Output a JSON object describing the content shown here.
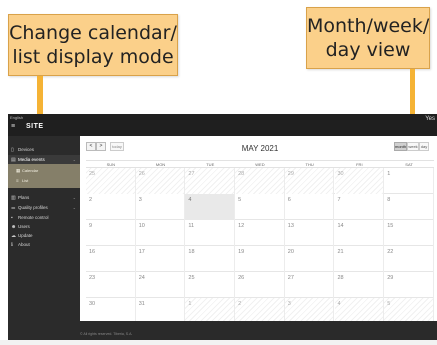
{
  "annotations": {
    "left_callout": [
      "Change calendar/",
      "list display mode"
    ],
    "right_callout": [
      "Month/week/",
      "day view"
    ]
  },
  "topbar": {
    "language": "English",
    "brand": "SITE",
    "user": "Yes"
  },
  "sidebar": {
    "items": [
      {
        "label": "Devices",
        "icon": "device-icon"
      },
      {
        "label": "Media events",
        "icon": "chart-icon"
      },
      {
        "label": "Plans",
        "icon": "grid-icon"
      },
      {
        "label": "Quality profiles",
        "icon": "sliders-icon"
      },
      {
        "label": "Remote control",
        "icon": "remote-icon"
      },
      {
        "label": "Users",
        "icon": "users-icon"
      },
      {
        "label": "Update",
        "icon": "cloud-icon"
      },
      {
        "label": "About",
        "icon": "info-icon"
      }
    ],
    "submenu": [
      {
        "label": "Calendar",
        "icon": "calendar-icon"
      },
      {
        "label": "List",
        "icon": "list-icon"
      }
    ]
  },
  "calendar": {
    "prev": "<",
    "next": ">",
    "today": "today",
    "title": "MAY 2021",
    "views": [
      "month",
      "week",
      "day"
    ],
    "active_view": "month",
    "weekdays": [
      "SUN",
      "MON",
      "TUE",
      "WED",
      "THU",
      "FRI",
      "SAT"
    ],
    "weeks": [
      [
        {
          "d": "25",
          "o": true
        },
        {
          "d": "26",
          "o": true
        },
        {
          "d": "27",
          "o": true
        },
        {
          "d": "28",
          "o": true
        },
        {
          "d": "29",
          "o": true
        },
        {
          "d": "30",
          "o": true
        },
        {
          "d": "1"
        }
      ],
      [
        {
          "d": "2"
        },
        {
          "d": "3"
        },
        {
          "d": "4",
          "t": true
        },
        {
          "d": "5"
        },
        {
          "d": "6"
        },
        {
          "d": "7"
        },
        {
          "d": "8"
        }
      ],
      [
        {
          "d": "9"
        },
        {
          "d": "10"
        },
        {
          "d": "11"
        },
        {
          "d": "12"
        },
        {
          "d": "13"
        },
        {
          "d": "14"
        },
        {
          "d": "15"
        }
      ],
      [
        {
          "d": "16"
        },
        {
          "d": "17"
        },
        {
          "d": "18"
        },
        {
          "d": "19"
        },
        {
          "d": "20"
        },
        {
          "d": "21"
        },
        {
          "d": "22"
        }
      ],
      [
        {
          "d": "23"
        },
        {
          "d": "24"
        },
        {
          "d": "25"
        },
        {
          "d": "26"
        },
        {
          "d": "27"
        },
        {
          "d": "28"
        },
        {
          "d": "29"
        }
      ],
      [
        {
          "d": "30"
        },
        {
          "d": "31"
        },
        {
          "d": "1",
          "o": true
        },
        {
          "d": "2",
          "o": true
        },
        {
          "d": "3",
          "o": true
        },
        {
          "d": "4",
          "o": true
        },
        {
          "d": "5",
          "o": true
        }
      ]
    ]
  },
  "footer": {
    "copyright": "© All rights reserved. Tiberia, S.A."
  },
  "colors": {
    "callout": "#fbd08a",
    "arrow": "#f5b335",
    "submenu": "#857f69"
  }
}
